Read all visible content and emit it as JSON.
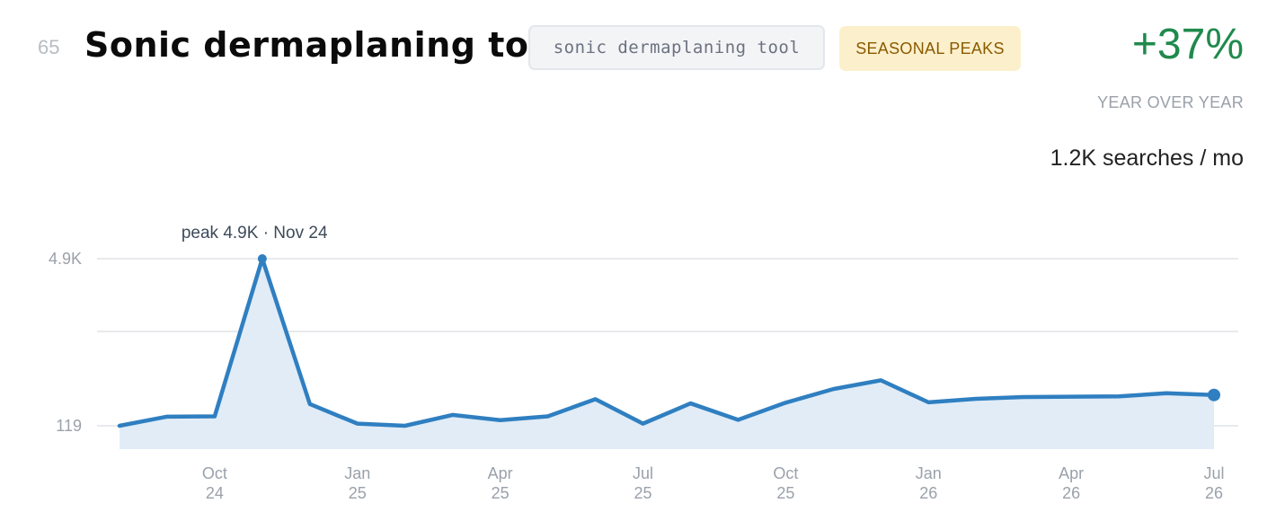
{
  "header": {
    "rank": "65",
    "title": "Sonic dermaplaning tools",
    "keyword_tag": "sonic dermaplaning tool",
    "seasonal_tag": "SEASONAL PEAKS",
    "yoy_value": "+37%",
    "yoy_label": "YEAR OVER YEAR",
    "searches": "1.2K searches / mo"
  },
  "colors": {
    "line": "#2f7fc1",
    "area": "#e1ecf7",
    "grid": "#e8eaed",
    "positive": "#1f8a4c",
    "season_bg": "#fcf0cc",
    "season_text": "#8a5a00"
  },
  "chart_data": {
    "type": "area",
    "ylim": [
      119,
      4900
    ],
    "y_ticks": [
      "4.9K",
      "119"
    ],
    "x_ticks": [
      {
        "month": "Oct",
        "year": "24"
      },
      {
        "month": "Jan",
        "year": "25"
      },
      {
        "month": "Apr",
        "year": "25"
      },
      {
        "month": "Jul",
        "year": "25"
      },
      {
        "month": "Oct",
        "year": "25"
      },
      {
        "month": "Jan",
        "year": "26"
      },
      {
        "month": "Apr",
        "year": "26"
      },
      {
        "month": "Jul",
        "year": "26"
      }
    ],
    "series": [
      {
        "x": [
          "2024-08",
          "2024-09",
          "2024-10",
          "2024-11",
          "2024-12",
          "2025-01",
          "2025-02",
          "2025-03",
          "2025-04",
          "2025-05",
          "2025-06",
          "2025-07",
          "2025-08",
          "2025-09",
          "2025-10",
          "2025-11",
          "2025-12",
          "2026-01",
          "2026-02",
          "2026-03",
          "2026-04",
          "2026-05",
          "2026-06",
          "2026-07"
        ],
        "values": [
          119,
          380,
          390,
          4900,
          740,
          180,
          119,
          430,
          280,
          390,
          880,
          180,
          760,
          290,
          780,
          1170,
          1420,
          790,
          890,
          940,
          950,
          960,
          1050,
          1000
        ]
      }
    ],
    "peak_annotation": "peak 4.9K · Nov 24",
    "grid": true
  }
}
